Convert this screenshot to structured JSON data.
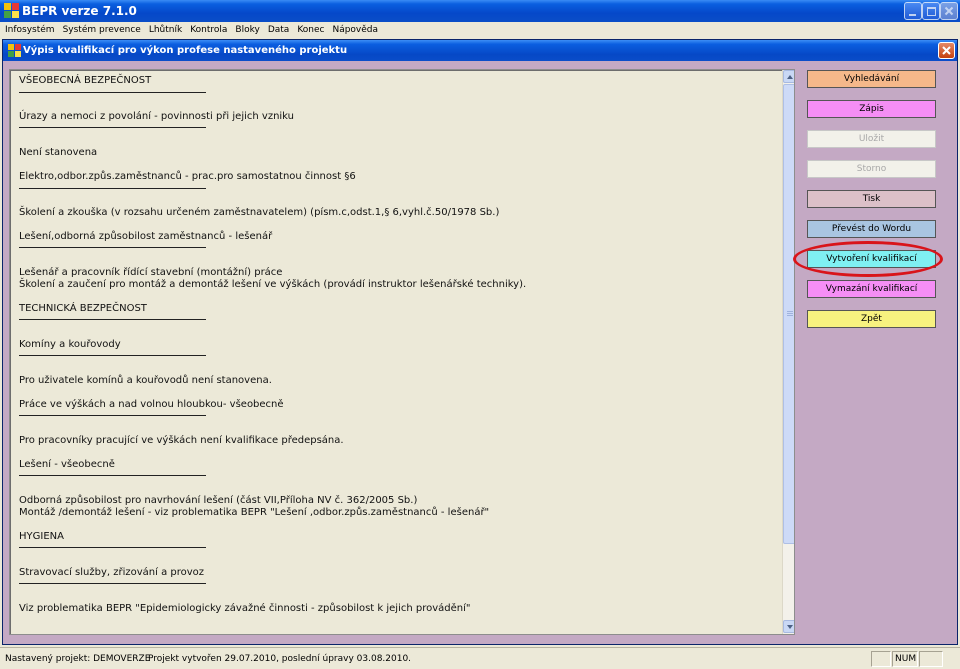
{
  "window": {
    "title": "BEPR verze 7.1.0"
  },
  "menu": [
    "Infosystém",
    "Systém prevence",
    "Lhůtník",
    "Kontrola",
    "Bloky",
    "Data",
    "Konec",
    "Nápověda"
  ],
  "dialog": {
    "title": "Výpis kvalifikací pro výkon profese nastaveného projektu"
  },
  "content": [
    {
      "text": "VŠEOBECNÁ BEZPEČNOST",
      "rule": true
    },
    {
      "text": "Úrazy a nemoci z povolání - povinnosti při jejich vzniku",
      "rule": true
    },
    {
      "text": "Není stanovena",
      "rule": false
    },
    {
      "text": "Elektro,odbor.způs.zaměstnanců - prac.pro samostatnou činnost §6",
      "rule": true
    },
    {
      "text": "Školení a zkouška (v rozsahu určeném zaměstnavatelem) (písm.c,odst.1,§ 6,vyhl.č.50/1978 Sb.)",
      "rule": false
    },
    {
      "text": "Lešení,odborná způsobilost zaměstnanců - lešenář",
      "rule": true
    },
    {
      "text": "Lešenář a pracovník řídící stavební (montážní) práce",
      "rule": false
    },
    {
      "text": "Školení a zaučení pro montáž a demontáž lešení ve výškách (provádí instruktor lešenářské techniky).",
      "rule": false
    },
    {
      "text": "TECHNICKÁ BEZPEČNOST",
      "rule": true
    },
    {
      "text": "Komíny a kouřovody",
      "rule": true
    },
    {
      "text": "Pro uživatele komínů a kouřovodů není stanovena.",
      "rule": false
    },
    {
      "text": "Práce ve výškách a nad volnou hloubkou- všeobecně",
      "rule": true
    },
    {
      "text": "Pro pracovníky pracující ve výškách není kvalifikace předepsána.",
      "rule": false
    },
    {
      "text": "Lešení - všeobecně",
      "rule": true
    },
    {
      "text": "Odborná způsobilost pro navrhování lešení (část VII,Příloha NV č. 362/2005 Sb.)",
      "rule": false
    },
    {
      "text": "Montáž /demontáž lešení - viz problematika BEPR \"Lešení ,odbor.způs.zaměstnanců - lešenář\"",
      "rule": false
    },
    {
      "text": "HYGIENA",
      "rule": true
    },
    {
      "text": "Stravovací služby, zřizování a provoz",
      "rule": true
    },
    {
      "text": "Viz problematika BEPR \"Epidemiologicky závažné činnosti - způsobilost k jejich provádění\"",
      "rule": false
    }
  ],
  "buttons": [
    {
      "label": "Vyhledávání",
      "color": "#f5b88a",
      "enabled": true
    },
    {
      "label": "Zápis",
      "color": "#f58ef5",
      "enabled": true
    },
    {
      "label": "Uložit",
      "color": "#f2f1ea",
      "enabled": false
    },
    {
      "label": "Storno",
      "color": "#f2f1ea",
      "enabled": false
    },
    {
      "label": "Tisk",
      "color": "#dcc0c8",
      "enabled": true
    },
    {
      "label": "Převést do Wordu",
      "color": "#a9c5e1",
      "enabled": true
    },
    {
      "label": "Vytvoření kvalifikací",
      "color": "#7ff0f2",
      "enabled": true
    },
    {
      "label": "Vymazání kvalifikací",
      "color": "#f58ef5",
      "enabled": true
    },
    {
      "label": "Zpět",
      "color": "#f7f27f",
      "enabled": true
    }
  ],
  "status": {
    "project": "Nastavený projekt: DEMOVERZE",
    "created": "Projekt vytvořen 29.07.2010, poslední úpravy 03.08.2010.",
    "num": "NUM"
  },
  "icons": {
    "app": "bepr-app-icon",
    "minimize": "minimize-icon",
    "maximize": "maximize-icon",
    "close": "close-icon",
    "scroll_up": "chevron-up-icon",
    "scroll_down": "chevron-down-icon"
  }
}
